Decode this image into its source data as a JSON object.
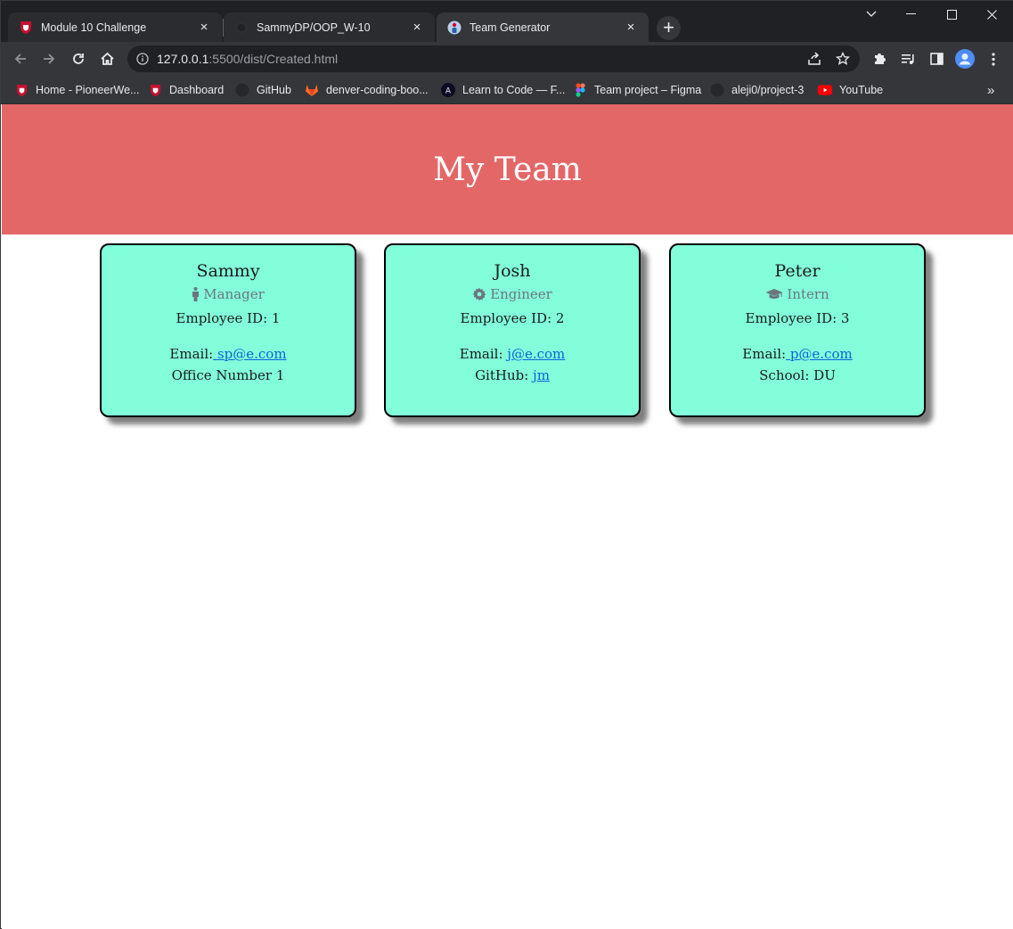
{
  "browser": {
    "tabs": [
      {
        "title": "Module 10 Challenge",
        "state": "inactive",
        "favicon": "shield-icon"
      },
      {
        "title": "SammyDP/OOP_W-10",
        "state": "inactive",
        "favicon": "github-icon"
      },
      {
        "title": "Team Generator",
        "state": "active",
        "favicon": "team-icon"
      }
    ],
    "url_host": "127.0.0.1",
    "url_path": ":5500/dist/Created.html",
    "bookmarks": [
      {
        "label": "Home - PioneerWe...",
        "icon": "shield-icon"
      },
      {
        "label": "Dashboard",
        "icon": "shield-icon"
      },
      {
        "label": "GitHub",
        "icon": "github-icon"
      },
      {
        "label": "denver-coding-boo...",
        "icon": "gitlab-icon"
      },
      {
        "label": "Learn to Code — F...",
        "icon": "freecodecamp-icon"
      },
      {
        "label": "Team project – Figma",
        "icon": "figma-icon"
      },
      {
        "label": "aleji0/project-3",
        "icon": "github-icon"
      },
      {
        "label": "YouTube",
        "icon": "youtube-icon"
      }
    ],
    "bookmarks_overflow": "»"
  },
  "page": {
    "heading": "My Team",
    "colors": {
      "header": "#e46767",
      "card": "#82ffda",
      "link": "#0a63d6"
    },
    "cards": [
      {
        "name": "Sammy",
        "role": "Manager",
        "role_icon": "person-icon",
        "id_line": "Employee ID: 1",
        "email_label": "Email:",
        "email": " sp@e.com",
        "extra_label": "Office Number 1",
        "extra_link": ""
      },
      {
        "name": "Josh",
        "role": "Engineer",
        "role_icon": "gear-icon",
        "id_line": "Employee ID: 2",
        "email_label": "Email: ",
        "email": "j@e.com",
        "extra_label": "GitHub: ",
        "extra_link": "jm"
      },
      {
        "name": "Peter",
        "role": "Intern",
        "role_icon": "graduation-cap-icon",
        "id_line": "Employee ID: 3",
        "email_label": "Email:",
        "email": " p@e.com",
        "extra_label": "School: DU",
        "extra_link": ""
      }
    ]
  }
}
